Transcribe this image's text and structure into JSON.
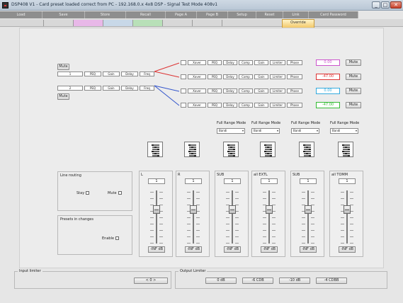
{
  "window": {
    "title": "DSP408 V1 - Card preset loaded correct from PC - 192.168.0.x 4x8 DSP - Signal Test Mode 408v1",
    "controls": [
      "_",
      "□",
      "✕"
    ]
  },
  "menu": {
    "tabs": [
      "Load",
      "Save",
      "Store",
      "Recall",
      "Page A",
      "Page B",
      "Setup",
      "Reset",
      "Link",
      "Card Password"
    ]
  },
  "subtabs": {
    "items": [
      "",
      "",
      "",
      "",
      "",
      "",
      "",
      "Override"
    ],
    "active_index": 7,
    "colors": [
      "#d0d0d0",
      "#d0d0d0",
      "#e8b8e8",
      "#c8d8e8",
      "#b8e0b8",
      "#d0d0d0",
      "#d0d0d0",
      "#f2c86a"
    ]
  },
  "routing": {
    "input_buttons": [
      "Mute",
      "Mute"
    ],
    "input_rows": [
      {
        "id": "1",
        "chips": [
          "PEQ",
          "Gain",
          "Delay",
          "Freq"
        ]
      },
      {
        "id": "2",
        "chips": [
          "PEQ",
          "Gain",
          "Delay",
          "Freq"
        ]
      }
    ],
    "output_rows": [
      {
        "chips": [
          "",
          "Xover",
          "PEQ",
          "Delay",
          "Comp",
          "Gain",
          "Limiter",
          "Phase"
        ],
        "value": "0.00",
        "value_color": "#cc55cc",
        "mute": "Mute"
      },
      {
        "chips": [
          "",
          "Xover",
          "PEQ",
          "Delay",
          "Comp",
          "Gain",
          "Limiter",
          "Phase"
        ],
        "value": "-47.00",
        "value_color": "#dd3333",
        "mute": "Mute"
      },
      {
        "chips": [
          "",
          "Xover",
          "PEQ",
          "Delay",
          "Comp",
          "Gain",
          "Limiter",
          "Phase"
        ],
        "value": "0.00",
        "value_color": "#33aadd",
        "mute": "Mute"
      },
      {
        "chips": [
          "",
          "Xover",
          "PEQ",
          "Delay",
          "Comp",
          "Gain",
          "Limiter",
          "Phase"
        ],
        "value": "-47.00",
        "value_color": "#33bb33",
        "mute": "Mute"
      }
    ],
    "line_colors": [
      "#dd3333",
      "#3355cc"
    ]
  },
  "filter_modes": [
    {
      "label": "Full Range Mode",
      "value": "Bandi"
    },
    {
      "label": "Full Range Mode",
      "value": "Bandi"
    },
    {
      "label": "Full Range Mode",
      "value": "Bandi"
    },
    {
      "label": "Full Range Mode",
      "value": "Bandi"
    }
  ],
  "channel_strips": [
    {
      "name": "L",
      "value": "1",
      "foot": "-INF dB"
    },
    {
      "name": "R",
      "value": "1",
      "foot": "-INF dB"
    },
    {
      "name": "SUB",
      "value": "1",
      "foot": "-INF dB"
    },
    {
      "name": "all EXTL",
      "value": "1",
      "foot": "-INF dB"
    },
    {
      "name": "SUB",
      "value": "1",
      "foot": "-INF dB"
    },
    {
      "name": "all TOMM",
      "value": "1",
      "foot": "-INF dB"
    }
  ],
  "left_panel": {
    "mute_group_title": "Line routing",
    "option_a": "Stay",
    "option_b": "Mute",
    "preset_group_title": "Presets in changes",
    "enable_label": "Enable"
  },
  "bottom": {
    "left_title": "Input limiter",
    "left_value": "< 0 >",
    "right_title": "Output Limiter",
    "buttons": [
      "0 dB",
      "-6 CDB",
      "-10 dB",
      "-4 CDBB"
    ]
  }
}
